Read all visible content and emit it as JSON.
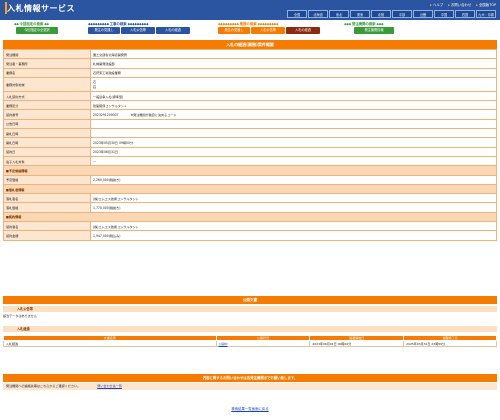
{
  "header": {
    "title": "入札情報サービス",
    "links": [
      "ヘルプ",
      "お問い合わせ",
      "全国版TOP"
    ],
    "regions": [
      "全国",
      "北海道",
      "東北",
      "関東",
      "北陸",
      "中部",
      "近畿",
      "中国",
      "四国",
      "九州・沖縄"
    ]
  },
  "nav": {
    "group1": {
      "label": "今回指定の検索",
      "buttons": [
        "今回指定の全選択"
      ]
    },
    "group2": {
      "label": "工事の検索",
      "buttons": [
        "発注の見通し",
        "入札公告等",
        "入札の経過"
      ]
    },
    "group3": {
      "label": "業務の検索",
      "buttons": [
        "発注の見通し",
        "入札公告等",
        "入札の経過"
      ]
    },
    "group4": {
      "label": "発注機関の検索",
      "buttons": [
        "発注機関情報"
      ]
    }
  },
  "page_title": "入札の経過(業務)案件概要",
  "details": [
    {
      "label": "発注機関",
      "value": "国土交通省北海道開発局"
    },
    {
      "label": "発注者・事務所",
      "value": "札幌開発建設部"
    },
    {
      "label": "業務名",
      "value": "石狩東工場建設業務"
    },
    {
      "label": "業務対象地域",
      "value": "石\n荘",
      "tall": true
    },
    {
      "label": "入札契約方式",
      "value": "一般競争入札(標準型)"
    },
    {
      "label": "業務区分",
      "value": "建築関係コンサルタント"
    },
    {
      "label": "契約番号",
      "value": "2023291200007",
      "extra": "※発注機関が独自に決めるコード"
    },
    {
      "label": "公告日時",
      "value": ""
    },
    {
      "label": "開札日時",
      "value": ""
    },
    {
      "label": "開札日時",
      "value": "2023年05月30日 09時00分"
    },
    {
      "label": "契約日",
      "value": "2023年06月31日"
    },
    {
      "label": "電子入札対象",
      "value": "ー"
    },
    {
      "section": "■予定価格情報"
    },
    {
      "label": "予定価格",
      "value": "2,260,000(税抜き)"
    },
    {
      "section": "■落札者情報"
    },
    {
      "label": "落札者名",
      "value": "(株)エムエス技術コンサルタント"
    },
    {
      "label": "落札価格",
      "value": "1,770,000(税抜き)"
    },
    {
      "section": "■契約情報"
    },
    {
      "label": "契約者名",
      "value": "(株)エムエス技術コンサルタント"
    },
    {
      "label": "契約金額",
      "value": "1,947,000(税込み)"
    }
  ],
  "public_docs": {
    "title": "公開文書",
    "notice_head": "入札公告等",
    "notice_empty": "該当データはありません",
    "result_head": "入札経過",
    "columns": [
      "文書名称",
      "公開状況",
      "掲載開始日",
      "掲載終了日"
    ],
    "rows": [
      {
        "name": "入札経過",
        "status": "公開中",
        "start": "2023年06月01日 00時00分",
        "end": "2025年03月31日 23時59分"
      }
    ]
  },
  "footer": {
    "bar": "内容に関するお問い合わせは各発注機関までお願い致します。",
    "contact_text": "発注機関への連絡先等はこちらからご確認ください。",
    "contact_link": "問い合わせ先一覧",
    "back_link": "検索結果一覧画面に戻る"
  },
  "colors": {
    "header": "#2b55a0",
    "accent": "#f57c00",
    "label_bg": "#fde6d0"
  }
}
